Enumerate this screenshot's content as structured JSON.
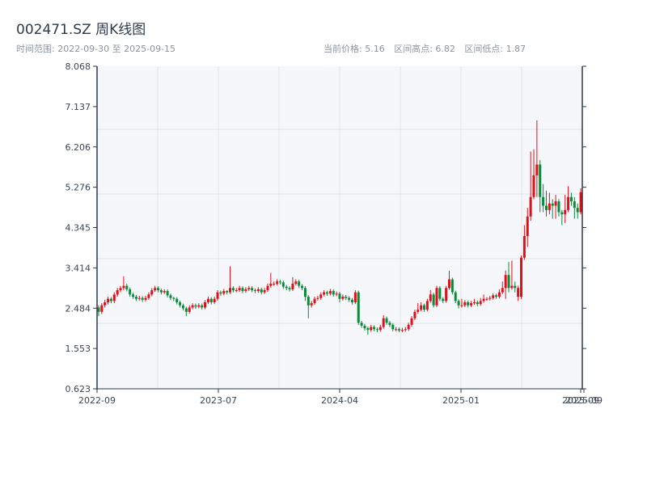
{
  "header": {
    "title": "002471.SZ 周K线图",
    "range_text": "时间范围: 2022-09-30 至 2025-09-15",
    "current_price": "当前价格: 5.16",
    "range_high": "区间高点: 6.82",
    "range_low": "区间低点: 1.87"
  },
  "chart_data": {
    "type": "candlestick",
    "title": "002471.SZ 周K线图",
    "interval": "weekly",
    "date_range": [
      "2022-09-30",
      "2025-09-15"
    ],
    "ylim": [
      0.623,
      8.068
    ],
    "y_ticks": [
      "8.068",
      "7.137",
      "6.206",
      "5.276",
      "4.345",
      "3.414",
      "2.484",
      "1.553",
      "0.623"
    ],
    "x_ticks": [
      "2022-09",
      "2023-07",
      "2024-04",
      "2025-01",
      "2025-09",
      "2025-09"
    ],
    "grid": true,
    "colors": {
      "up": "#e0101a",
      "down": "#0a8a3a",
      "plot_bg": "#f5f7fa",
      "axis": "#2d3a4a"
    },
    "ohlc_fields": [
      "open",
      "high",
      "low",
      "close"
    ],
    "ohlc": [
      [
        2.5,
        2.55,
        2.3,
        2.4
      ],
      [
        2.4,
        2.6,
        2.35,
        2.55
      ],
      [
        2.55,
        2.68,
        2.5,
        2.62
      ],
      [
        2.62,
        2.75,
        2.57,
        2.7
      ],
      [
        2.7,
        2.74,
        2.6,
        2.65
      ],
      [
        2.65,
        2.85,
        2.6,
        2.8
      ],
      [
        2.8,
        2.95,
        2.75,
        2.9
      ],
      [
        2.9,
        3.0,
        2.85,
        2.95
      ],
      [
        2.95,
        3.22,
        2.9,
        3.0
      ],
      [
        3.0,
        3.05,
        2.87,
        2.92
      ],
      [
        2.92,
        2.96,
        2.75,
        2.8
      ],
      [
        2.8,
        2.84,
        2.7,
        2.75
      ],
      [
        2.75,
        2.79,
        2.65,
        2.7
      ],
      [
        2.7,
        2.77,
        2.66,
        2.72
      ],
      [
        2.72,
        2.76,
        2.63,
        2.68
      ],
      [
        2.68,
        2.77,
        2.64,
        2.72
      ],
      [
        2.72,
        2.85,
        2.68,
        2.8
      ],
      [
        2.8,
        2.95,
        2.76,
        2.9
      ],
      [
        2.9,
        3.0,
        2.86,
        2.95
      ],
      [
        2.95,
        2.99,
        2.85,
        2.9
      ],
      [
        2.9,
        2.94,
        2.8,
        2.85
      ],
      [
        2.85,
        2.92,
        2.81,
        2.88
      ],
      [
        2.88,
        2.92,
        2.73,
        2.78
      ],
      [
        2.78,
        2.82,
        2.67,
        2.72
      ],
      [
        2.72,
        2.75,
        2.65,
        2.7
      ],
      [
        2.7,
        2.74,
        2.57,
        2.62
      ],
      [
        2.62,
        2.66,
        2.5,
        2.55
      ],
      [
        2.55,
        2.59,
        2.43,
        2.48
      ],
      [
        2.48,
        2.52,
        2.3,
        2.4
      ],
      [
        2.4,
        2.55,
        2.36,
        2.5
      ],
      [
        2.5,
        2.6,
        2.46,
        2.55
      ],
      [
        2.55,
        2.59,
        2.47,
        2.52
      ],
      [
        2.52,
        2.6,
        2.48,
        2.55
      ],
      [
        2.55,
        2.59,
        2.45,
        2.5
      ],
      [
        2.5,
        2.67,
        2.46,
        2.62
      ],
      [
        2.62,
        2.75,
        2.58,
        2.7
      ],
      [
        2.7,
        2.74,
        2.57,
        2.62
      ],
      [
        2.62,
        2.75,
        2.58,
        2.7
      ],
      [
        2.7,
        2.9,
        2.66,
        2.85
      ],
      [
        2.85,
        2.89,
        2.77,
        2.82
      ],
      [
        2.82,
        2.93,
        2.78,
        2.88
      ],
      [
        2.88,
        2.9,
        2.8,
        2.85
      ],
      [
        2.85,
        3.45,
        2.81,
        2.95
      ],
      [
        2.95,
        2.99,
        2.85,
        2.9
      ],
      [
        2.9,
        2.95,
        2.85,
        2.9
      ],
      [
        2.9,
        3.0,
        2.86,
        2.95
      ],
      [
        2.95,
        2.99,
        2.83,
        2.88
      ],
      [
        2.88,
        2.97,
        2.84,
        2.92
      ],
      [
        2.92,
        3.0,
        2.88,
        2.95
      ],
      [
        2.95,
        2.99,
        2.85,
        2.9
      ],
      [
        2.9,
        2.94,
        2.83,
        2.88
      ],
      [
        2.88,
        2.97,
        2.84,
        2.92
      ],
      [
        2.92,
        2.96,
        2.8,
        2.85
      ],
      [
        2.85,
        2.95,
        2.81,
        2.9
      ],
      [
        2.9,
        3.05,
        2.86,
        3.0
      ],
      [
        3.0,
        3.3,
        2.96,
        3.05
      ],
      [
        3.05,
        3.1,
        3.0,
        3.05
      ],
      [
        3.05,
        3.15,
        3.01,
        3.1
      ],
      [
        3.1,
        3.14,
        3.03,
        3.08
      ],
      [
        3.08,
        3.12,
        2.93,
        2.98
      ],
      [
        2.98,
        3.02,
        2.9,
        2.95
      ],
      [
        2.95,
        2.99,
        2.87,
        2.92
      ],
      [
        2.92,
        3.2,
        2.88,
        3.05
      ],
      [
        3.05,
        3.15,
        3.01,
        3.1
      ],
      [
        3.1,
        3.14,
        2.95,
        3.0
      ],
      [
        3.0,
        3.04,
        2.9,
        2.95
      ],
      [
        2.95,
        2.99,
        2.65,
        2.75
      ],
      [
        2.75,
        2.79,
        2.25,
        2.55
      ],
      [
        2.55,
        2.65,
        2.5,
        2.6
      ],
      [
        2.6,
        2.75,
        2.56,
        2.7
      ],
      [
        2.7,
        2.77,
        2.66,
        2.72
      ],
      [
        2.72,
        2.85,
        2.68,
        2.8
      ],
      [
        2.8,
        2.9,
        2.76,
        2.85
      ],
      [
        2.85,
        2.89,
        2.77,
        2.82
      ],
      [
        2.82,
        2.93,
        2.78,
        2.88
      ],
      [
        2.88,
        2.92,
        2.75,
        2.8
      ],
      [
        2.8,
        2.87,
        2.76,
        2.82
      ],
      [
        2.82,
        2.86,
        2.62,
        2.7
      ],
      [
        2.7,
        2.8,
        2.66,
        2.75
      ],
      [
        2.75,
        2.79,
        2.67,
        2.72
      ],
      [
        2.72,
        2.76,
        2.63,
        2.68
      ],
      [
        2.68,
        2.72,
        2.57,
        2.62
      ],
      [
        2.62,
        2.9,
        2.58,
        2.85
      ],
      [
        2.85,
        2.89,
        2.1,
        2.15
      ],
      [
        2.15,
        2.19,
        2.03,
        2.08
      ],
      [
        2.08,
        2.12,
        1.97,
        2.02
      ],
      [
        2.02,
        2.06,
        1.87,
        1.98
      ],
      [
        1.98,
        2.1,
        1.94,
        2.05
      ],
      [
        2.05,
        2.09,
        1.95,
        2.0
      ],
      [
        2.0,
        2.04,
        1.93,
        1.98
      ],
      [
        1.98,
        2.1,
        1.94,
        2.05
      ],
      [
        2.05,
        2.32,
        2.01,
        2.25
      ],
      [
        2.25,
        2.29,
        2.1,
        2.15
      ],
      [
        2.15,
        2.19,
        2.05,
        2.1
      ],
      [
        2.1,
        2.14,
        1.95,
        2.0
      ],
      [
        2.0,
        2.05,
        1.95,
        2.0
      ],
      [
        2.0,
        2.04,
        1.93,
        1.97
      ],
      [
        1.97,
        2.03,
        1.93,
        1.98
      ],
      [
        1.98,
        2.05,
        1.94,
        2.0
      ],
      [
        2.0,
        2.15,
        1.96,
        2.1
      ],
      [
        2.1,
        2.3,
        2.06,
        2.25
      ],
      [
        2.25,
        2.45,
        2.21,
        2.4
      ],
      [
        2.4,
        2.6,
        2.36,
        2.45
      ],
      [
        2.45,
        2.62,
        2.41,
        2.55
      ],
      [
        2.55,
        2.59,
        2.4,
        2.45
      ],
      [
        2.45,
        2.7,
        2.41,
        2.65
      ],
      [
        2.65,
        2.9,
        2.61,
        2.8
      ],
      [
        2.8,
        2.84,
        2.5,
        2.55
      ],
      [
        2.55,
        3.0,
        2.51,
        2.95
      ],
      [
        2.95,
        2.99,
        2.65,
        2.7
      ],
      [
        2.7,
        2.74,
        2.6,
        2.65
      ],
      [
        2.65,
        3.0,
        2.61,
        2.95
      ],
      [
        2.95,
        3.35,
        2.91,
        3.15
      ],
      [
        3.15,
        3.19,
        2.8,
        2.85
      ],
      [
        2.85,
        2.89,
        2.6,
        2.65
      ],
      [
        2.65,
        2.69,
        2.48,
        2.55
      ],
      [
        2.55,
        2.7,
        2.5,
        2.55
      ],
      [
        2.55,
        2.67,
        2.51,
        2.62
      ],
      [
        2.62,
        2.66,
        2.5,
        2.55
      ],
      [
        2.55,
        2.65,
        2.51,
        2.6
      ],
      [
        2.6,
        2.7,
        2.56,
        2.62
      ],
      [
        2.62,
        2.66,
        2.53,
        2.58
      ],
      [
        2.58,
        2.72,
        2.54,
        2.65
      ],
      [
        2.65,
        2.8,
        2.61,
        2.7
      ],
      [
        2.7,
        2.74,
        2.65,
        2.7
      ],
      [
        2.7,
        2.77,
        2.66,
        2.72
      ],
      [
        2.72,
        2.83,
        2.68,
        2.78
      ],
      [
        2.78,
        2.82,
        2.7,
        2.75
      ],
      [
        2.75,
        2.92,
        2.71,
        2.85
      ],
      [
        2.85,
        3.1,
        2.81,
        2.95
      ],
      [
        2.95,
        3.35,
        2.7,
        3.25
      ],
      [
        3.25,
        3.55,
        2.85,
        2.95
      ],
      [
        2.95,
        3.58,
        2.91,
        3.0
      ],
      [
        3.0,
        3.1,
        2.85,
        2.95
      ],
      [
        2.75,
        3.0,
        2.65,
        2.95
      ],
      [
        2.75,
        3.7,
        2.7,
        3.65
      ],
      [
        3.65,
        4.4,
        3.6,
        4.15
      ],
      [
        4.15,
        4.8,
        3.9,
        4.6
      ],
      [
        4.6,
        6.1,
        4.5,
        5.05
      ],
      [
        5.05,
        6.15,
        5.0,
        5.55
      ],
      [
        5.55,
        6.82,
        5.05,
        5.8
      ],
      [
        5.8,
        5.9,
        4.7,
        5.05
      ],
      [
        5.05,
        5.35,
        4.7,
        4.85
      ],
      [
        4.85,
        5.2,
        4.6,
        4.75
      ],
      [
        4.75,
        5.15,
        4.65,
        4.9
      ],
      [
        4.9,
        5.0,
        4.55,
        4.85
      ],
      [
        4.85,
        5.1,
        4.55,
        4.95
      ],
      [
        4.95,
        5.0,
        4.6,
        4.7
      ],
      [
        4.7,
        4.75,
        4.4,
        4.65
      ],
      [
        4.65,
        5.1,
        4.45,
        4.75
      ],
      [
        4.75,
        5.3,
        4.7,
        5.05
      ],
      [
        5.05,
        5.15,
        4.85,
        4.95
      ],
      [
        4.95,
        5.05,
        4.55,
        4.8
      ],
      [
        4.8,
        4.9,
        4.55,
        4.7
      ],
      [
        4.7,
        5.25,
        4.65,
        5.16
      ]
    ]
  }
}
